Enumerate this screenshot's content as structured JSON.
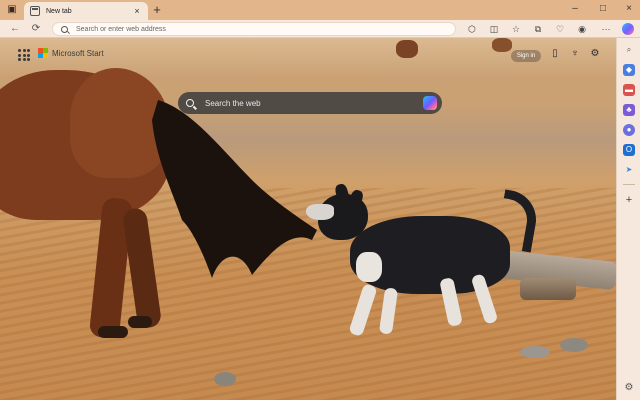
{
  "tab": {
    "title": "New tab",
    "close": "×"
  },
  "titlebar": {
    "newtab": "+",
    "minimize": "–",
    "maximize": "□",
    "close": "×",
    "sidebar_icon": "▣"
  },
  "toolbar": {
    "back": "←",
    "refresh": "⟳",
    "address_placeholder": "Search or enter web address",
    "more": "···"
  },
  "start_page": {
    "brand": "Microsoft Start",
    "sign_in": "Sign in",
    "search_placeholder": "Search the web"
  },
  "brand_colors": {
    "red": "#f25022",
    "green": "#7fba00",
    "blue": "#00a4ef",
    "yellow": "#ffb900"
  },
  "icons": {
    "toolbar": [
      "extensions-icon",
      "split-screen-icon",
      "favorites-icon",
      "collections-icon",
      "browser-essentials-icon",
      "profile-icon",
      "more-icon",
      "copilot-icon"
    ],
    "start_page": [
      "apps-launcher-icon",
      "phone-icon",
      "rewards-icon",
      "settings-icon"
    ],
    "sidebar": [
      "search-icon",
      "shopping-tag-icon",
      "toolbox-icon",
      "games-icon",
      "copilot-sidebar-icon",
      "outlook-icon",
      "send-icon",
      "add-icon",
      "sidebar-settings-icon"
    ]
  },
  "sidebar": {
    "add": "+",
    "settings": "⚙"
  }
}
